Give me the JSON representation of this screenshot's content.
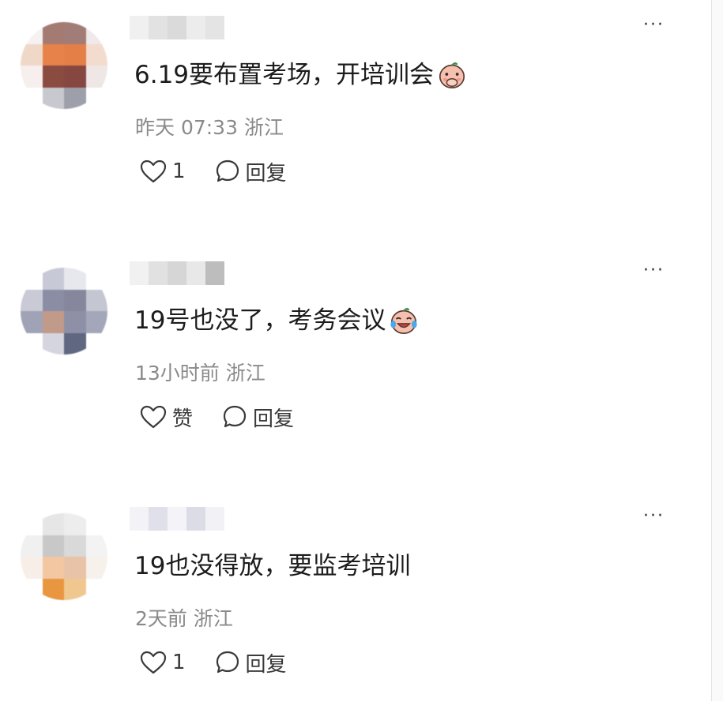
{
  "comments": [
    {
      "content": "6.19要布置考场，开培训会",
      "emoji": "cover-face-emoji",
      "meta": "昨天 07:33 浙江",
      "like_label": "1",
      "reply_label": "回复",
      "more_label": "···"
    },
    {
      "content": "19号也没了，考务会议",
      "emoji": "laugh-cry-emoji",
      "meta": "13小时前 浙江",
      "like_label": "赞",
      "reply_label": "回复",
      "more_label": "···"
    },
    {
      "content": "19也没得放，要监考培训",
      "emoji": "",
      "meta": "2天前 浙江",
      "like_label": "1",
      "reply_label": "回复",
      "more_label": "···"
    }
  ],
  "icons": {
    "like": "heart-outline-icon",
    "reply": "speech-bubble-icon",
    "more": "more-dots-icon"
  },
  "colors": {
    "text": "#1c1c1c",
    "meta": "#8a8a8a",
    "action": "#3a3a3a",
    "emoji_face": "#f2b9a8"
  }
}
